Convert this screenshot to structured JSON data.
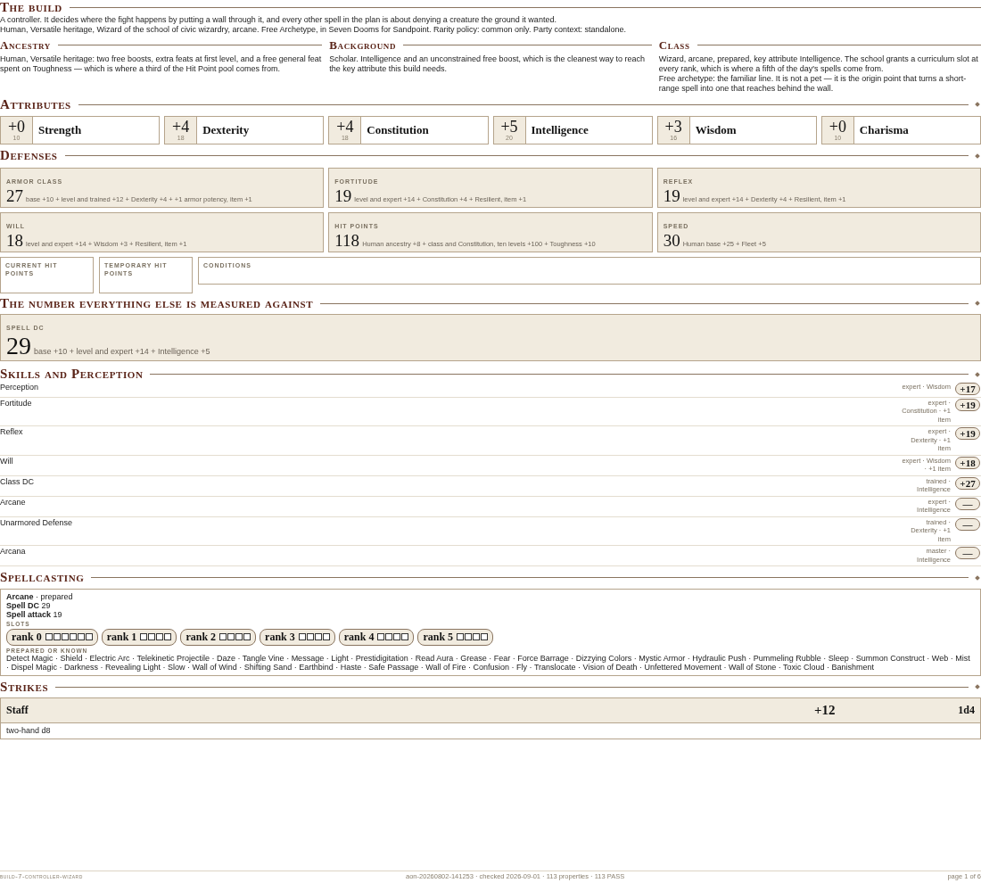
{
  "build": {
    "heading": "The build",
    "lines": [
      "A controller. It decides where the fight happens by putting a wall through it, and every other spell in the plan is about denying a creature the ground it wanted.",
      "Human, Versatile heritage, Wizard of the school of civic wizardry, arcane. Free Archetype, in Seven Dooms for Sandpoint. Rarity policy: common only. Party context: standalone."
    ]
  },
  "intro_sections": [
    {
      "heading": "Ancestry",
      "paragraphs": [
        "Human, Versatile heritage: two free boosts, extra feats at first level, and a free general feat spent on Toughness — which is where a third of the Hit Point pool comes from."
      ]
    },
    {
      "heading": "Background",
      "paragraphs": [
        "Scholar. Intelligence and an unconstrained free boost, which is the cleanest way to reach the key attribute this build needs."
      ]
    },
    {
      "heading": "Class",
      "paragraphs": [
        "Wizard, arcane, prepared, key attribute Intelligence. The school grants a curriculum slot at every rank, which is where a fifth of the day's spells come from.",
        "Free archetype: the familiar line. It is not a pet — it is the origin point that turns a short-range spell into one that reaches behind the wall."
      ]
    }
  ],
  "attributes": {
    "heading": "Attributes",
    "items": [
      {
        "modifier": "+0",
        "score": "10",
        "name": "Strength"
      },
      {
        "modifier": "+4",
        "score": "18",
        "name": "Dexterity"
      },
      {
        "modifier": "+4",
        "score": "18",
        "name": "Constitution"
      },
      {
        "modifier": "+5",
        "score": "20",
        "name": "Intelligence"
      },
      {
        "modifier": "+3",
        "score": "16",
        "name": "Wisdom"
      },
      {
        "modifier": "+0",
        "score": "10",
        "name": "Charisma"
      }
    ]
  },
  "defenses": {
    "heading": "Defenses",
    "cards": [
      {
        "label": "ARMOR CLASS",
        "value": "27",
        "breakdown": "base +10 + level and trained +12 + Dexterity +4 + +1 armor potency, item +1"
      },
      {
        "label": "FORTITUDE",
        "value": "19",
        "breakdown": "level and expert +14 + Constitution +4 + Resilient, item +1"
      },
      {
        "label": "REFLEX",
        "value": "19",
        "breakdown": "level and expert +14 + Dexterity +4 + Resilient, item +1"
      },
      {
        "label": "WILL",
        "value": "18",
        "breakdown": "level and expert +14 + Wisdom +3 + Resilient, item +1"
      },
      {
        "label": "HIT POINTS",
        "value": "118",
        "breakdown": "Human ancestry +8 + class and Constitution, ten levels +100 + Toughness +10"
      },
      {
        "label": "SPEED",
        "value": "30",
        "breakdown": "Human base +25 + Fleet +5"
      }
    ],
    "trackers": [
      {
        "label": "CURRENT HIT POINTS"
      },
      {
        "label": "TEMPORARY HIT POINTS"
      },
      {
        "label": "CONDITIONS"
      }
    ]
  },
  "spell_dc_section": {
    "heading": "The number everything else is measured against",
    "card": {
      "label": "SPELL DC",
      "value": "29",
      "breakdown": "base +10 + level and expert +14 + Intelligence +5"
    }
  },
  "skills": {
    "heading": "Skills and Perception",
    "rows": [
      {
        "name": "Perception",
        "detail": "expert · Wisdom",
        "bonus": "+17"
      },
      {
        "name": "Fortitude",
        "detail": "expert · Constitution · +1 item",
        "bonus": "+19"
      },
      {
        "name": "Reflex",
        "detail": "expert · Dexterity · +1 item",
        "bonus": "+19"
      },
      {
        "name": "Will",
        "detail": "expert · Wisdom · +1 item",
        "bonus": "+18"
      },
      {
        "name": "Class DC",
        "detail": "trained · Intelligence",
        "bonus": "+27"
      },
      {
        "name": "Arcane",
        "detail": "expert · Intelligence",
        "bonus": "—"
      },
      {
        "name": "Unarmored Defense",
        "detail": "trained · Dexterity · +1 item",
        "bonus": "—"
      },
      {
        "name": "Arcana",
        "detail": "master · Intelligence",
        "bonus": "—"
      }
    ]
  },
  "spellcasting": {
    "heading": "Spellcasting",
    "lines": [
      "**Arcane** · prepared",
      "**Spell DC** 29",
      "**Spell attack** 19"
    ],
    "slots_label": "SLOTS",
    "ranks": [
      {
        "label": "rank 0",
        "slots": [
          {
            "used": false
          },
          {
            "used": false
          },
          {
            "used": false
          },
          {
            "used": false
          },
          {
            "used": false
          },
          {
            "used": false
          }
        ]
      },
      {
        "label": "rank 1",
        "slots": [
          {
            "used": false
          },
          {
            "used": false
          },
          {
            "used": false
          },
          {
            "used": false
          }
        ]
      },
      {
        "label": "rank 2",
        "slots": [
          {
            "used": false
          },
          {
            "used": false
          },
          {
            "used": false
          },
          {
            "used": false
          }
        ]
      },
      {
        "label": "rank 3",
        "slots": [
          {
            "used": false
          },
          {
            "used": false
          },
          {
            "used": false
          },
          {
            "used": false
          }
        ]
      },
      {
        "label": "rank 4",
        "slots": [
          {
            "used": false
          },
          {
            "used": false
          },
          {
            "used": false
          },
          {
            "used": false
          }
        ]
      },
      {
        "label": "rank 5",
        "slots": [
          {
            "used": false
          },
          {
            "used": false
          },
          {
            "used": false
          },
          {
            "used": false
          }
        ]
      }
    ],
    "known_label": "PREPARED OR KNOWN",
    "spells": "Detect Magic · Shield · Electric Arc · Telekinetic Projectile · Daze · Tangle Vine · Message · Light · Prestidigitation · Read Aura · Grease · Fear · Force Barrage · Dizzying Colors · Mystic Armor · Hydraulic Push · Pummeling Rubble · Sleep · Summon Construct · Web · Mist · Dispel Magic · Darkness · Revealing Light · Slow · Wall of Wind · Shifting Sand · Earthbind · Haste · Safe Passage · Wall of Fire · Confusion · Fly · Translocate · Vision of Death · Unfettered Movement · Wall of Stone · Toxic Cloud · Banishment"
  },
  "strikes": {
    "heading": "Strikes",
    "items": [
      {
        "name": "Staff",
        "attack": "+12",
        "damage": "1d4",
        "traits": "two-hand d8"
      }
    ]
  },
  "footer": {
    "left": "build-7-controller-wizard",
    "center": "aon-20260802-141253 · checked 2026-09-01 · 113 properties · 113 PASS",
    "right": "page 1 of 6"
  }
}
